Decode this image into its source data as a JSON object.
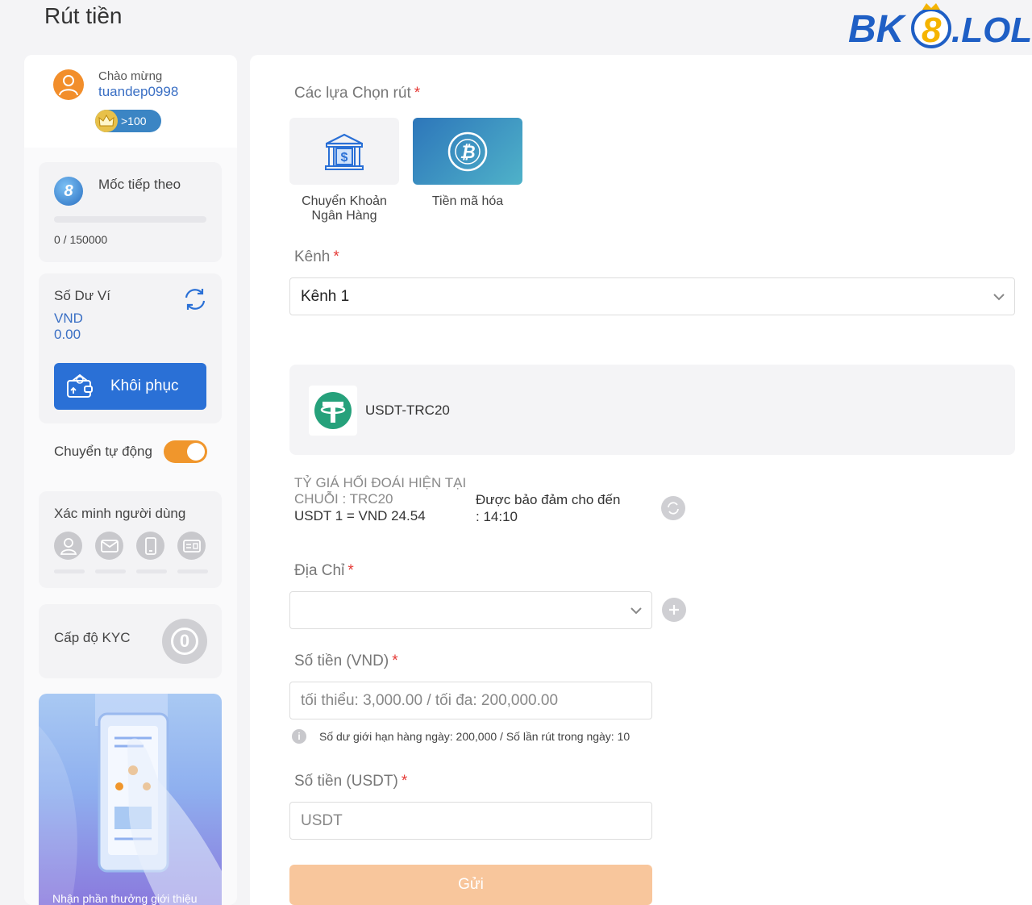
{
  "page": {
    "title": "Rút tiền"
  },
  "logo": {
    "text": "BK8.LOL"
  },
  "sidebar": {
    "greeting": "Chào mừng",
    "username": "tuandep0998",
    "vip_badge": ">100",
    "milestone": {
      "label": "Mốc tiếp theo",
      "icon_digit": "8",
      "value": "0 / 150000",
      "progress": 0
    },
    "balance": {
      "label": "Số Dư Ví",
      "currency": "VND",
      "amount": "0.00",
      "restore_label": "Khôi phục"
    },
    "auto_transfer": {
      "label": "Chuyển tự động",
      "enabled": true
    },
    "verification": {
      "label": "Xác minh người dùng",
      "icons": [
        "user-icon",
        "email-icon",
        "phone-icon",
        "id-card-icon"
      ]
    },
    "kyc": {
      "label": "Cấp độ KYC",
      "level": "0"
    },
    "promo": {
      "text": "Nhận phần thưởng giới thiệu"
    }
  },
  "form": {
    "options_label": "Các lựa Chọn rút",
    "required_mark": "*",
    "methods": [
      {
        "name_line1": "Chuyển Khoản",
        "name_line2": "Ngân Hàng",
        "selected": false
      },
      {
        "name_line1": "Tiền mã hóa",
        "selected": true
      }
    ],
    "channel_label": "Kênh",
    "channel_value": "Kênh 1",
    "token_name": "USDT-TRC20",
    "rate": {
      "heading": "TỶ GIÁ HỐI ĐOÁI HIỆN TẠI",
      "chain": "CHUỖI : TRC20",
      "value": "USDT 1 = VND 24.54",
      "guarantee_line1": "Được bảo đảm cho đến",
      "guarantee_line2": ": 14:10"
    },
    "address_label": "Địa Chỉ",
    "amount_vnd_label": "Số tiền (VND)",
    "amount_vnd_placeholder": "tối thiểu: 3,000.00 / tối đa: 200,000.00",
    "limit_note": "Số dư giới hạn hàng ngày: 200,000 / Số lần rút trong ngày: 10",
    "amount_usdt_label": "Số tiền (USDT)",
    "amount_usdt_placeholder": "USDT",
    "submit_label": "Gửi"
  },
  "colors": {
    "accent_blue": "#2a70d6",
    "orange": "#f0962c",
    "submit_disabled": "#f8c69c",
    "tether_green": "#26a17b"
  }
}
